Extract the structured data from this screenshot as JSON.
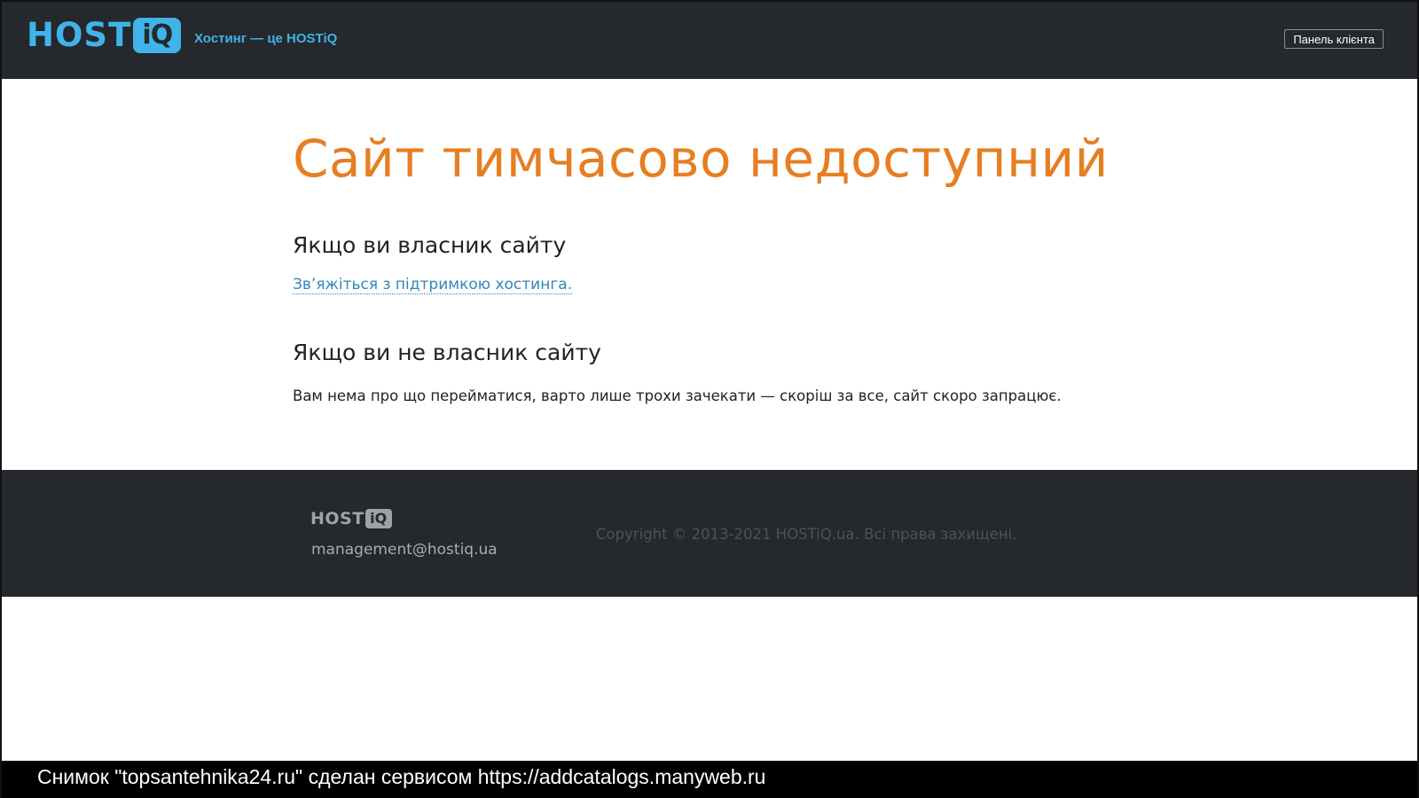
{
  "header": {
    "logo_host": "HOST",
    "logo_iq": "iQ",
    "tagline": "Хостинг — це HOSTiQ",
    "panel_button": "Панель клієнта"
  },
  "main": {
    "title": "Сайт тимчасово недоступний",
    "owner_heading": "Якщо ви власник сайту",
    "support_link": "Зв’яжіться з підтримкою хостинга.",
    "visitor_heading": "Якщо ви не власник сайту",
    "visitor_message": "Вам нема про що перейматися, варто лише трохи зачекати — скоріш за все, сайт скоро запрацює."
  },
  "footer": {
    "logo_host": "HOST",
    "logo_iq": "iQ",
    "email": "management@hostiq.ua",
    "copyright": "Copyright © 2013-2021 HOSTiQ.ua. Всі права захищені."
  },
  "caption": {
    "text": "Снимок \"topsantehnika24.ru\" сделан сервисом https://addcatalogs.manyweb.ru"
  },
  "colors": {
    "header_bg": "#25282c",
    "brand_blue": "#3fb3ea",
    "title_orange": "#e67e22",
    "link_blue": "#2f87b8"
  }
}
